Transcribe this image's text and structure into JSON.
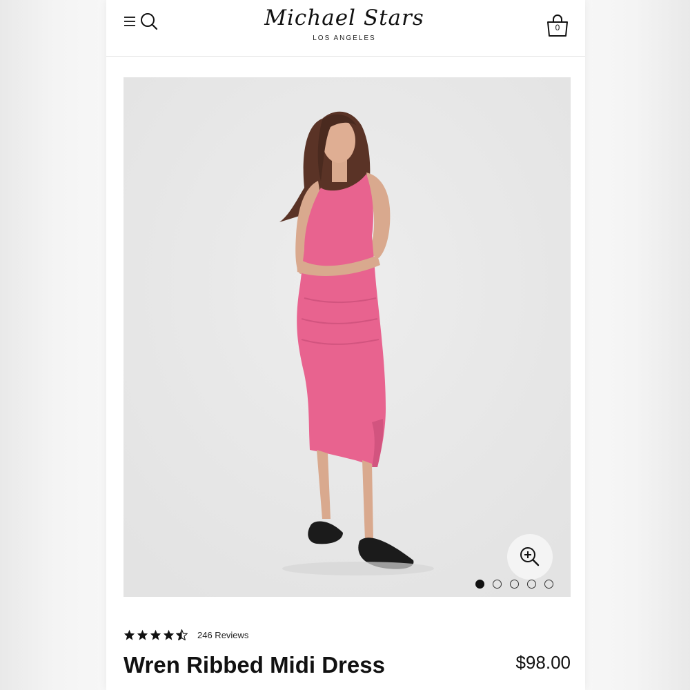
{
  "header": {
    "brand_name": "Michael Stars",
    "brand_location": "LOS ANGELES",
    "cart_count": "0",
    "icons": [
      "menu-icon",
      "search-icon",
      "shopping-bag-icon"
    ]
  },
  "gallery": {
    "image_count": 5,
    "active_index": 0,
    "background_color": "#e9e9e9",
    "dress_color": "#e8638f",
    "zoom_icon": "zoom-in-icon"
  },
  "product": {
    "rating": 4.5,
    "reviews_label": "246 Reviews",
    "title": "Wren Ribbed Midi Dress",
    "price": "$98.00"
  }
}
